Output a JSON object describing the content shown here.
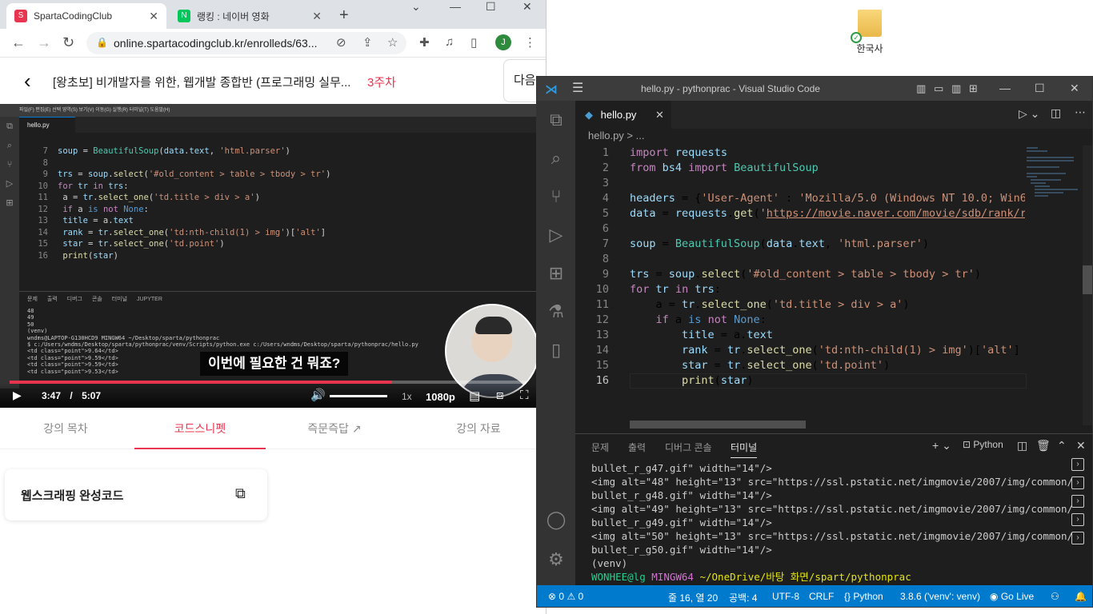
{
  "desktop": {
    "folder_label": "한국사"
  },
  "chrome": {
    "tabs": [
      {
        "title": "SpartaCodingClub",
        "active": true
      },
      {
        "title": "랭킹 : 네이버 영화",
        "active": false
      }
    ],
    "url": "online.spartacodingclub.kr/enrolleds/63...",
    "profile_initial": "J"
  },
  "page": {
    "course_title": "[왕초보] 비개발자를 위한, 웹개발 종합반 (프로그래밍 실무...",
    "week": "3주차",
    "next_label": "다음",
    "tabs": [
      "강의 목차",
      "코드스니펫",
      "즉문즉답",
      "강의 자료"
    ],
    "active_tab": "코드스니펫",
    "snippet_title": "웹스크래핑 완성코드"
  },
  "video": {
    "subtitle": "이번에 필요한 건 뭐죠?",
    "current_time": "3:47",
    "separator": "/",
    "duration": "5:07",
    "progress": 0.74,
    "speed": "1x",
    "quality": "1080p",
    "editor_tab": "hello.py",
    "breadcrumb": "hello.py > ...",
    "window_title": "pythonprac",
    "code_lines": [
      {
        "n": "7",
        "text": "soup = BeautifulSoup(data.text, 'html.parser')"
      },
      {
        "n": "8",
        "text": ""
      },
      {
        "n": "9",
        "text": "trs = soup.select('#old_content > table > tbody > tr')"
      },
      {
        "n": "10",
        "text": "for tr in trs:"
      },
      {
        "n": "11",
        "text": "    a = tr.select_one('td.title > div > a')"
      },
      {
        "n": "12",
        "text": "    if a is not None:"
      },
      {
        "n": "13",
        "text": "        title = a.text"
      },
      {
        "n": "14",
        "text": "        rank = tr.select_one('td:nth-child(1) > img')['alt']"
      },
      {
        "n": "15",
        "text": "        star = tr.select_one('td.point')"
      },
      {
        "n": "16",
        "text": "        print(star)"
      }
    ],
    "panel_tabs": [
      "문제",
      "출력",
      "디버그 콘솔",
      "터미널",
      "JUPYTER"
    ],
    "terminal_lines": [
      "48",
      "49",
      "50",
      "(venv)",
      "wndms@LAPTOP-G130HCD9 MINGW64 ~/Desktop/sparta/pythonprac",
      "$ c:/Users/wndms/Desktop/sparta/pythonprac/venv/Scripts/python.exe c:/Users/wndms/Desktop/sparta/pythonprac/hello.py",
      "<td class=\"point\">9.64</td>",
      "<td class=\"point\">9.59</td>",
      "<td class=\"point\">9.59</td>",
      "<td class=\"point\">9.53</td>"
    ]
  },
  "vscode": {
    "window_title": "hello.py - pythonprac - Visual Studio Code",
    "tab": "hello.py",
    "breadcrumb": "hello.py > ...",
    "code": [
      {
        "n": "1",
        "text": "import requests"
      },
      {
        "n": "2",
        "text": "from bs4 import BeautifulSoup"
      },
      {
        "n": "3",
        "text": ""
      },
      {
        "n": "4",
        "text": "headers = {'User-Agent' : 'Mozilla/5.0 (Windows NT 10.0; Win64; x"
      },
      {
        "n": "5",
        "text": "data = requests.get('https://movie.naver.com/movie/sdb/rank/rmovi"
      },
      {
        "n": "6",
        "text": ""
      },
      {
        "n": "7",
        "text": "soup = BeautifulSoup(data.text, 'html.parser')"
      },
      {
        "n": "8",
        "text": ""
      },
      {
        "n": "9",
        "text": "trs = soup.select('#old_content > table > tbody > tr')"
      },
      {
        "n": "10",
        "text": "for tr in trs:"
      },
      {
        "n": "11",
        "text": "    a = tr.select_one('td.title > div > a')"
      },
      {
        "n": "12",
        "text": "    if a is not None:"
      },
      {
        "n": "13",
        "text": "        title = a.text"
      },
      {
        "n": "14",
        "text": "        rank = tr.select_one('td:nth-child(1) > img')['alt']"
      },
      {
        "n": "15",
        "text": "        star = tr.select_one('td.point')"
      },
      {
        "n": "16",
        "text": "        print(star)"
      }
    ],
    "panel_tabs": [
      "문제",
      "출력",
      "디버그 콘솔",
      "터미널"
    ],
    "active_panel_tab": "터미널",
    "terminal_profile": "Python",
    "terminal": [
      "bullet_r_g47.gif\" width=\"14\"/>",
      "<img alt=\"48\" height=\"13\" src=\"https://ssl.pstatic.net/imgmovie/2007/img/common/",
      "bullet_r_g48.gif\" width=\"14\"/>",
      "<img alt=\"49\" height=\"13\" src=\"https://ssl.pstatic.net/imgmovie/2007/img/common/",
      "bullet_r_g49.gif\" width=\"14\"/>",
      "<img alt=\"50\" height=\"13\" src=\"https://ssl.pstatic.net/imgmovie/2007/img/common/",
      "bullet_r_g50.gif\" width=\"14\"/>",
      "(venv)"
    ],
    "prompt_user": "WONHEE@lg",
    "prompt_env": "MINGW64",
    "prompt_path": "~/OneDrive/바탕 화면/spart/pythonprac",
    "status": {
      "errors": "0",
      "warnings": "0",
      "position": "줄 16, 열 20",
      "spaces": "공백: 4",
      "encoding": "UTF-8",
      "eol": "CRLF",
      "language": "Python",
      "interpreter": "3.8.6 ('venv': venv)",
      "golive": "Go Live"
    }
  },
  "colors": {
    "accent": "#e8344e",
    "vscode_status": "#007acc"
  }
}
